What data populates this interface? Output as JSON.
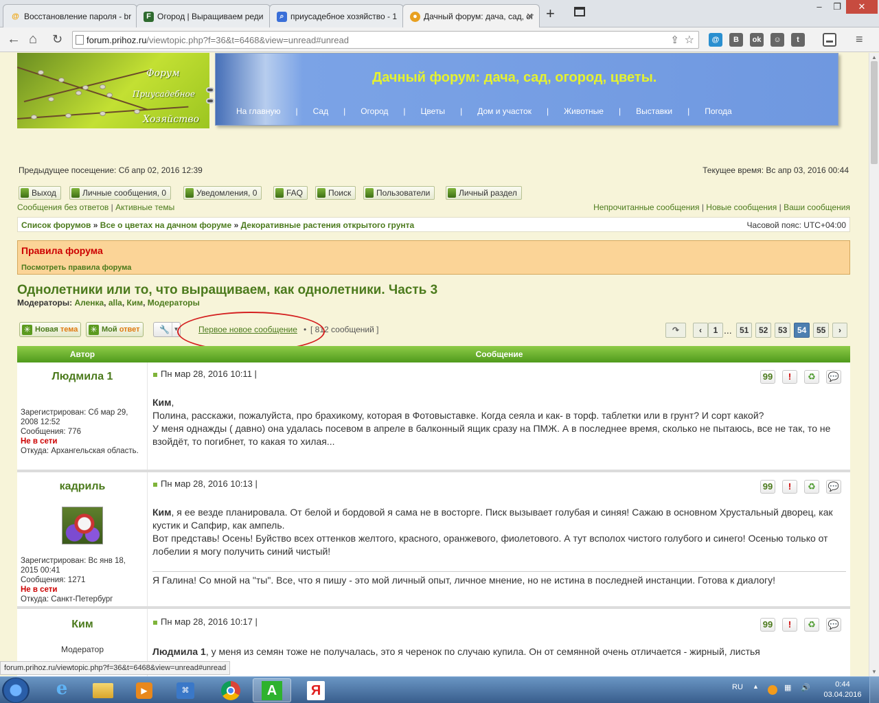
{
  "browser": {
    "tabs": [
      {
        "label": "Восстановление пароля - br",
        "icon": "mail-at-icon",
        "color": "#f0a000"
      },
      {
        "label": "Огород | Выращиваем реди",
        "icon": "site-f-icon",
        "color": "#2f6b2f"
      },
      {
        "label": "приусадебное хозяйство - 1",
        "icon": "search-icon",
        "color": "#3a6fd8"
      },
      {
        "label": "Дачный форум: дача, сад, ог",
        "icon": "apple-icon",
        "color": "#e8a020"
      }
    ],
    "url_host": "forum.prihoz.ru",
    "url_path": "/viewtopic.php?f=36&t=6468&view=unread#unread",
    "ext_mail": "@",
    "ext_vk": "B",
    "ext_ok": "ok",
    "ext_smile": "☺",
    "ext_twitter": "t",
    "status_url": "forum.prihoz.ru/viewtopic.php?f=36&t=6468&view=unread#unread"
  },
  "header": {
    "logo_word1": "Форум",
    "logo_word2": "Приусадебное",
    "logo_word3": "Хозяйство",
    "title": "Дачный форум: дача, сад, огород, цветы.",
    "nav": [
      "На главную",
      "Сад",
      "Огород",
      "Цветы",
      "Дом и участок",
      "Животные",
      "Выставки",
      "Погода"
    ]
  },
  "info": {
    "last_visit": "Предыдущее посещение: Сб апр 02, 2016 12:39",
    "current_time": "Текущее время: Вс апр 03, 2016 00:44"
  },
  "user_buttons": [
    "Выход",
    "Личные сообщения, 0",
    "Уведомления, 0",
    "FAQ",
    "Поиск",
    "Пользователи",
    "Личный раздел"
  ],
  "links_left": [
    "Сообщения без ответов",
    "Активные темы"
  ],
  "links_right": [
    "Непрочитанные сообщения",
    "Новые сообщения",
    "Ваши сообщения"
  ],
  "breadcrumbs": {
    "items": [
      "Список форумов",
      "Все о цветах на дачном форуме",
      "Декоративные растения открытого грунта"
    ],
    "sep": "»",
    "timezone": "Часовой пояс: UTC+04:00"
  },
  "rules": {
    "title": "Правила форума",
    "link": "Посмотреть правила форума"
  },
  "topic": {
    "title": "Однолетники или то, что выращиваем, как однолетники. Часть 3",
    "mods_label": "Модераторы:",
    "mods": [
      "Аленка",
      "alla",
      "Ким",
      "Модераторы"
    ]
  },
  "actions": {
    "new_topic_1": "Новая",
    "new_topic_2": "тема",
    "reply_1": "Мой",
    "reply_2": "ответ",
    "first_new": "Первое новое сообщение",
    "bullet": "•",
    "post_count": "[ 812 сообщений ]",
    "pages": [
      "1",
      "51",
      "52",
      "53",
      "54",
      "55"
    ],
    "current_page": "54",
    "dots": "..."
  },
  "table": {
    "col_author": "Автор",
    "col_message": "Сообщение"
  },
  "posts": [
    {
      "author": "Людмила 1",
      "date": "Пн мар 28, 2016 10:11 |",
      "registered": "Зарегистрирован: Сб мар 29, 2008 12:52",
      "messages": "Сообщения: 776",
      "status": "Не в сети",
      "from": "Откуда: Архангельская область.",
      "addressee": "Ким",
      "body": ",\nПолина, расскажи, пожалуйста, про брахикому, которая в Фотовыставке. Когда сеяла и как- в торф. таблетки или в грунт? И сорт какой?\nУ меня однажды ( давно) она удалась посевом в апреле в балконный ящик сразу на ПМЖ. А в последнее время, сколько не пытаюсь, все не так, то не взойдёт, то погибнет, то какая то хилая..."
    },
    {
      "author": "кадриль",
      "date": "Пн мар 28, 2016 10:13 |",
      "registered": "Зарегистрирован: Вс янв 18, 2015 00:41",
      "messages": "Сообщения: 1271",
      "status": "Не в сети",
      "from": "Откуда: Санкт-Петербург",
      "addressee": "Ким",
      "body": ", я ее везде планировала. От белой и бордовой я сама не в восторге. Писк вызывает голубая и синяя! Сажаю в основном Хрустальный дворец, как кустик и Сапфир, как ампель.\nВот представь! Осень! Буйство всех оттенков желтого, красного, оранжевого, фиолетового. А тут всполох чистого голубого и синего! Осенью только от лобелии я могу получить синий чистый!",
      "signature": "Я Галина! Со мной на \"ты\". Все, что я пишу - это мой личный опыт, личное мнение, но не истина в последней инстанции. Готова к диалогу!"
    },
    {
      "author": "Ким",
      "date": "Пн мар 28, 2016 10:17 |",
      "rank": "Модератор",
      "addressee": "Людмила 1",
      "body": ", у меня из семян тоже не получалась, это я черенок по случаю купила. Он от семянной очень отличается - жирный, листья"
    }
  ],
  "post_buttons": {
    "quote": "99",
    "report": "!"
  },
  "taskbar": {
    "lang": "RU",
    "time": "0:44",
    "date": "03.04.2016",
    "apps": [
      "ie-icon",
      "explorer-icon",
      "media-player-icon",
      "network-icon",
      "chrome-icon",
      "green-a-icon",
      "yandex-icon"
    ]
  }
}
